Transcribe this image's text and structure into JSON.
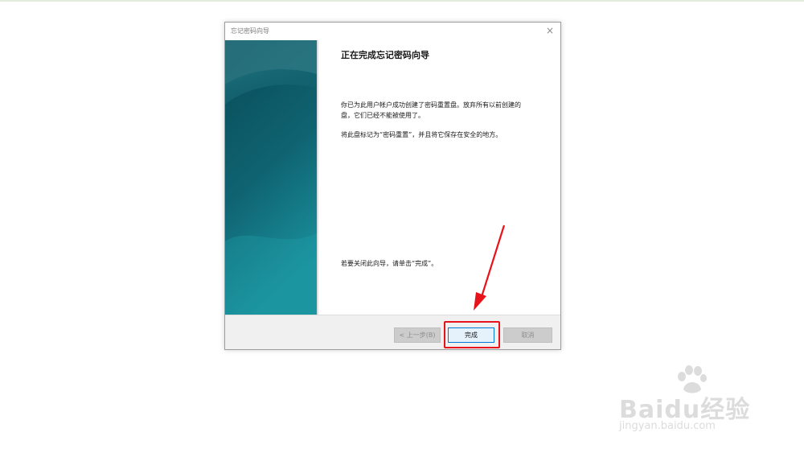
{
  "dialog": {
    "title": "忘记密码向导",
    "close_glyph": "×",
    "heading": "正在完成忘记密码向导",
    "paragraph1": "你已为此用户帐户成功创建了密码重置盘。放弃所有以前创建的盘，它们已经不能被使用了。",
    "paragraph2": "将此盘标记为“密码重置”，并且将它保存在安全的地方。",
    "paragraph3": "若要关闭此向导，请单击“完成”。",
    "buttons": {
      "back_label": "< 上一步(B)",
      "finish_label": "完成",
      "cancel_label": "取消"
    }
  },
  "annotation": {
    "color": "#e8131a"
  },
  "watermark": {
    "brand": "Baidu经验",
    "url": "jingyan.baidu.com"
  },
  "colors": {
    "side_panel_dark": "#0c4b58",
    "side_panel_light": "#1c8c99",
    "accent_focus": "#0078d7"
  }
}
